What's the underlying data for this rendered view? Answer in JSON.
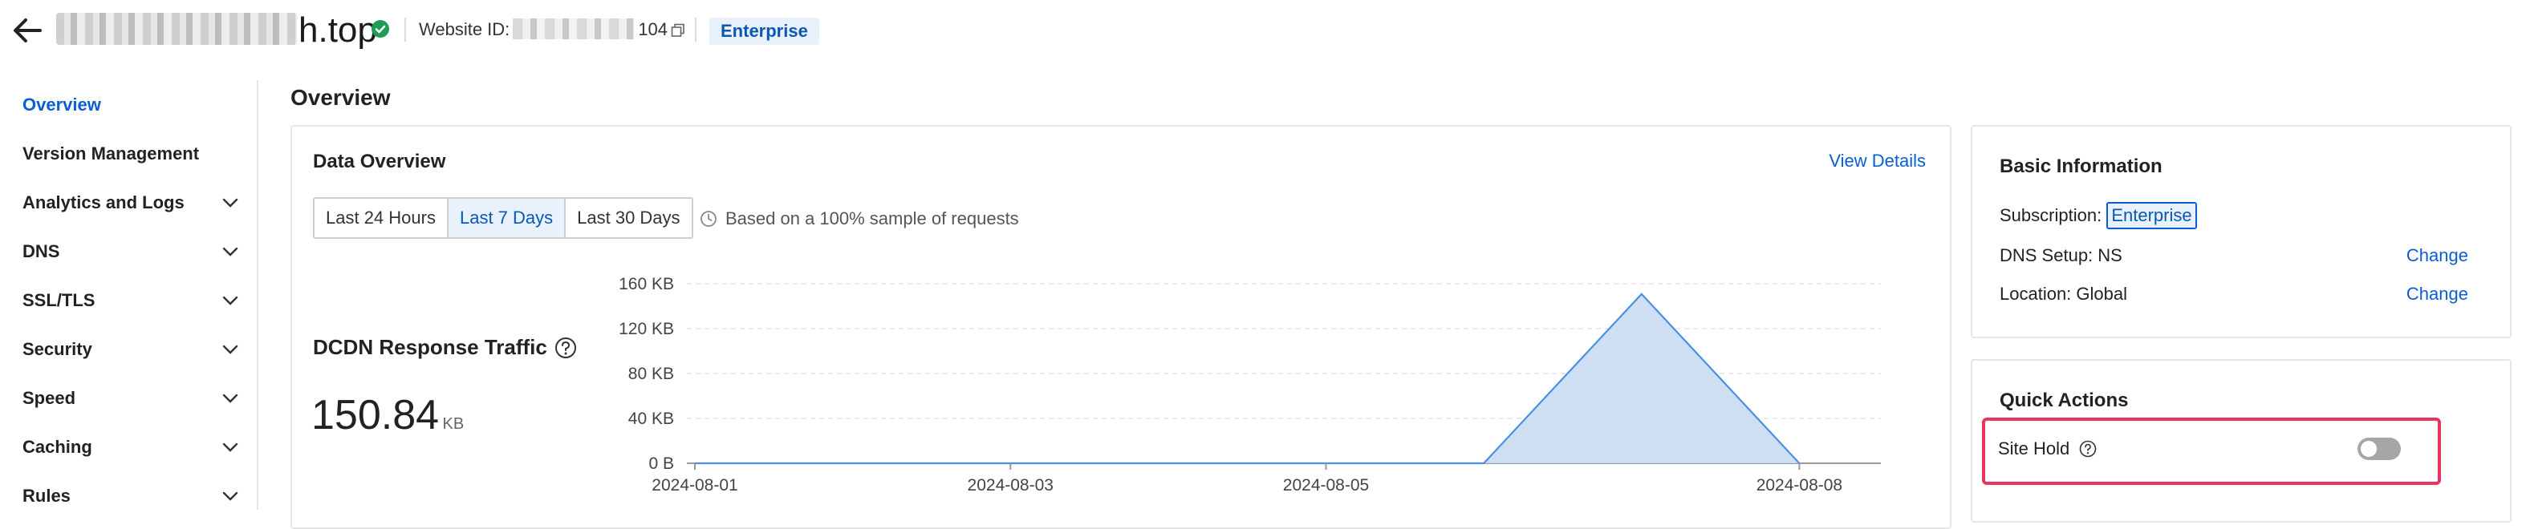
{
  "header": {
    "site_name_suffix": "h.top",
    "website_id_label": "Website ID:",
    "website_id_suffix": "104",
    "tier_tag": "Enterprise"
  },
  "sidebar": {
    "items": [
      {
        "label": "Overview",
        "active": true
      },
      {
        "label": "Version Management"
      },
      {
        "label": "Analytics and Logs"
      },
      {
        "label": "DNS"
      },
      {
        "label": "SSL/TLS"
      },
      {
        "label": "Security"
      },
      {
        "label": "Speed"
      },
      {
        "label": "Caching"
      },
      {
        "label": "Rules"
      }
    ]
  },
  "main": {
    "title": "Overview",
    "data_overview": {
      "title": "Data Overview",
      "view_details": "View Details",
      "ranges": [
        "Last 24 Hours",
        "Last 7 Days",
        "Last 30 Days"
      ],
      "active_range": "Last 7 Days",
      "sample_note": "Based on a 100% sample of requests",
      "metric_label": "DCDN Response Traffic",
      "metric_value": "150.84",
      "metric_unit": "KB"
    }
  },
  "right": {
    "basic": {
      "title": "Basic Information",
      "subscription_label": "Subscription:",
      "subscription_value": "Enterprise",
      "dns_setup": "DNS Setup: NS",
      "location": "Location: Global",
      "change_label": "Change"
    },
    "quick": {
      "title": "Quick Actions",
      "site_hold_label": "Site Hold",
      "site_hold_on": false
    }
  },
  "chart_data": {
    "type": "area",
    "x": [
      "2024-08-01",
      "2024-08-02",
      "2024-08-03",
      "2024-08-04",
      "2024-08-05",
      "2024-08-06",
      "2024-08-07",
      "2024-08-08"
    ],
    "x_tick_labels": [
      "2024-08-01",
      "2024-08-03",
      "2024-08-05",
      "2024-08-08"
    ],
    "values": [
      0,
      0,
      0,
      0,
      0,
      0,
      150.84,
      0
    ],
    "y_ticks": [
      0,
      40,
      80,
      120,
      160
    ],
    "y_tick_labels": [
      "0 B",
      "40 KB",
      "80 KB",
      "120 KB",
      "160 KB"
    ],
    "ylim": [
      0,
      160
    ],
    "grid": true,
    "color": "#4a90e2",
    "fill": "#c9dcf3"
  },
  "colors": {
    "accent": "#0a5fd0",
    "success": "#1f9d55",
    "highlight": "#e8365d"
  }
}
